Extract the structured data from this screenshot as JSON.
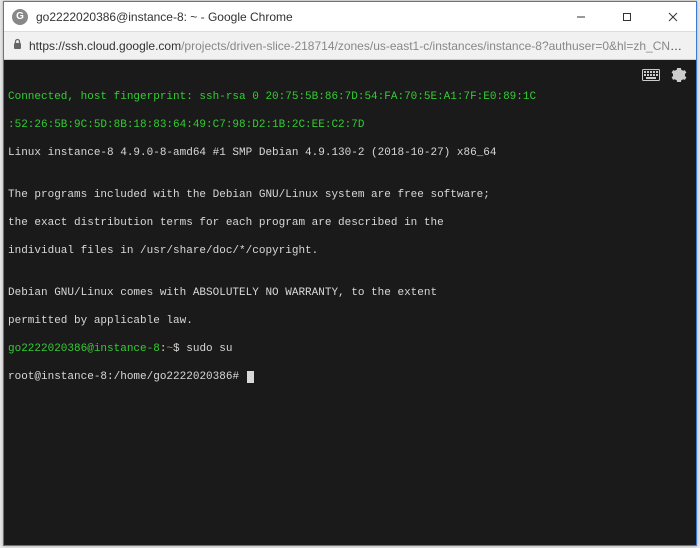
{
  "window": {
    "title": "go2222020386@instance-8: ~ - Google Chrome",
    "favicon_letter": "G"
  },
  "addressbar": {
    "scheme_host": "https://ssh.cloud.google.com",
    "path": "/projects/driven-slice-218714/zones/us-east1-c/instances/instance-8?authuser=0&hl=zh_CN&..."
  },
  "terminal": {
    "line_connect": "Connected, host fingerprint: ssh-rsa 0 20:75:5B:86:7D:54:FA:70:5E:A1:7F:E0:89:1C",
    "line_fp2": ":52:26:5B:9C:5D:8B:18:83:64:49:C7:98:D2:1B:2C:EE:C2:7D",
    "line_kernel": "Linux instance-8 4.9.0-8-amd64 #1 SMP Debian 4.9.130-2 (2018-10-27) x86_64",
    "line_blank1": "",
    "line_programs1": "The programs included with the Debian GNU/Linux system are free software;",
    "line_programs2": "the exact distribution terms for each program are described in the",
    "line_programs3": "individual files in /usr/share/doc/*/copyright.",
    "line_blank2": "",
    "line_warranty1": "Debian GNU/Linux comes with ABSOLUTELY NO WARRANTY, to the extent",
    "line_warranty2": "permitted by applicable law.",
    "prompt1_user": "go2222020386@instance-8",
    "prompt1_sep": ":",
    "prompt1_path": "~",
    "prompt1_end": "$ ",
    "cmd1": "sudo su",
    "prompt2_userhost": "root@instance-8:",
    "prompt2_path": "/home/go2222020386",
    "prompt2_end": "# "
  }
}
